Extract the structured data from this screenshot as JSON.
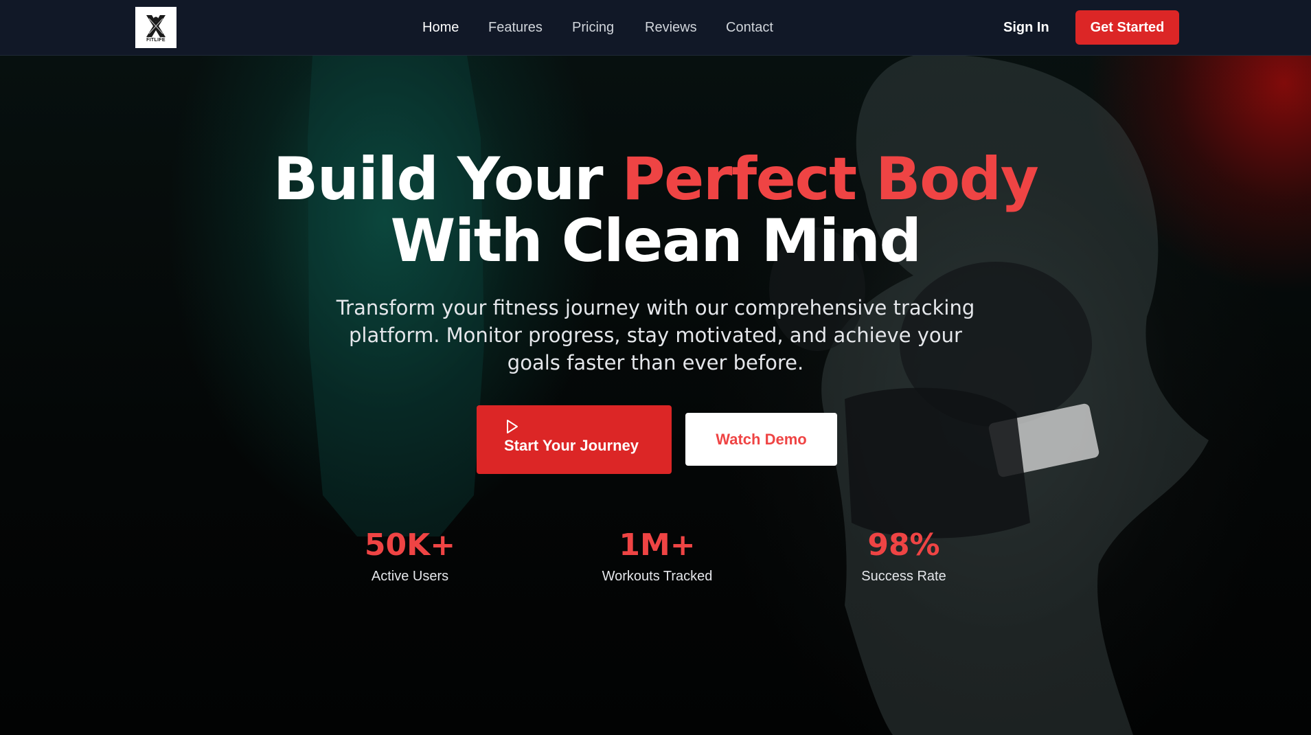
{
  "brand": {
    "logo_text": "FITLIFE",
    "accent_color": "#dc2626",
    "accent_text_color": "#ef4444"
  },
  "nav": {
    "links": [
      {
        "label": "Home",
        "active": true
      },
      {
        "label": "Features",
        "active": false
      },
      {
        "label": "Pricing",
        "active": false
      },
      {
        "label": "Reviews",
        "active": false
      },
      {
        "label": "Contact",
        "active": false
      }
    ],
    "sign_in": "Sign In",
    "cta": "Get Started"
  },
  "hero": {
    "headline_part1": "Build Your ",
    "headline_accent": "Perfect Body",
    "headline_line2": "With Clean Mind",
    "subtitle": "Transform your fitness journey with our comprehensive tracking platform. Monitor progress, stay motivated, and achieve your goals faster than ever before.",
    "primary_button": {
      "label": "Start Your Journey",
      "icon": "play-icon"
    },
    "secondary_button": {
      "label": "Watch Demo"
    }
  },
  "stats": [
    {
      "value": "50K+",
      "label": "Active Users"
    },
    {
      "value": "1M+",
      "label": "Workouts Tracked"
    },
    {
      "value": "98%",
      "label": "Success Rate"
    }
  ]
}
